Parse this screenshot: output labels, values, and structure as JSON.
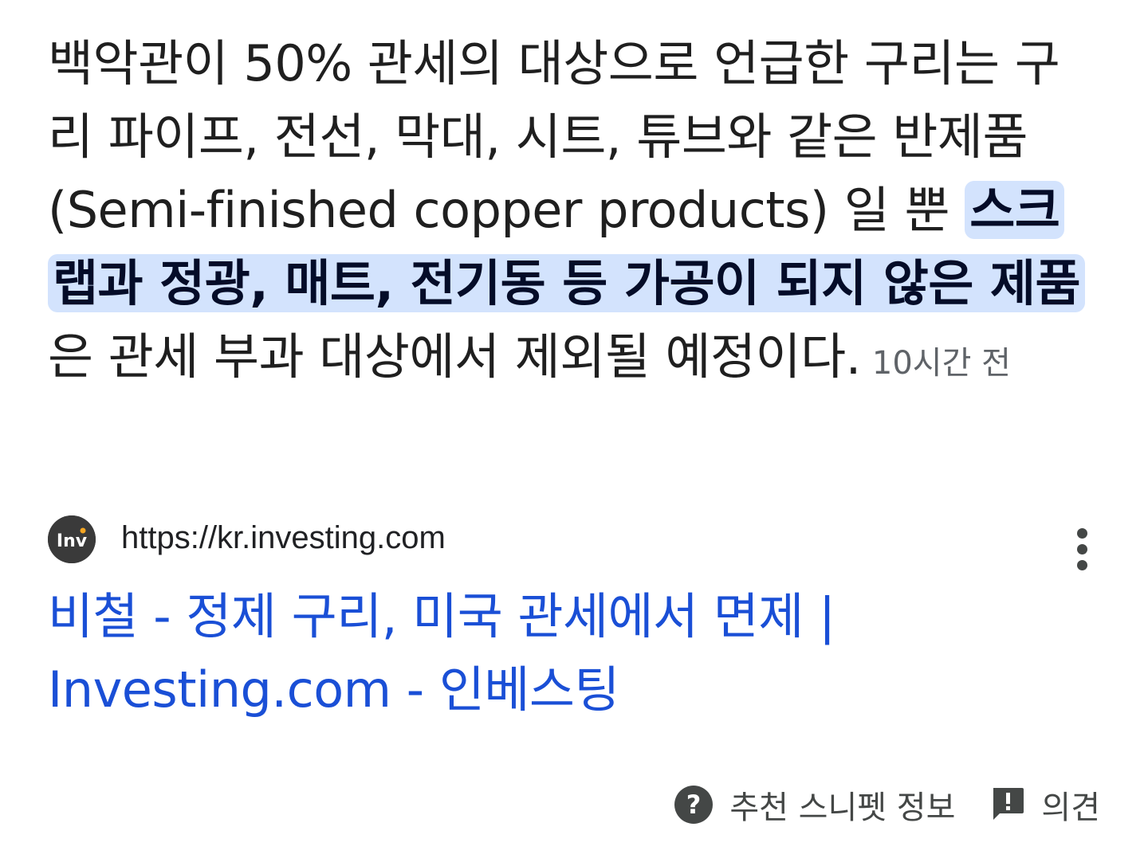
{
  "snippet": {
    "text_before": "백악관이 50% 관세의 대상으로 언급한 구리는 구리 파이프, 전선, 막대, 시트, 튜브와 같은 반제품(Semi-finished copper products) 일 뿐 ",
    "highlight": "스크랩과 정광, 매트, 전기동 등 가공이 되지 않은 제품",
    "text_after": "은 관세 부과 대상에서 제외될 예정이다.",
    "age": "10시간 전"
  },
  "source": {
    "favicon_text": "Inv",
    "url": "https://kr.investing.com"
  },
  "result": {
    "title": "비철 - 정제 구리, 미국 관세에서 면제 | Investing.com - 인베스팅"
  },
  "footer": {
    "about_label": "추천 스니펫 정보",
    "feedback_label": "의견"
  },
  "colors": {
    "link": "#1a4fd6",
    "highlight_bg": "#d3e3fd",
    "text": "#1f1f1f",
    "muted": "#5f6368"
  },
  "icons": {
    "favicon": "investing-logo-icon",
    "more": "more-vert-icon",
    "about": "help-circle-icon",
    "feedback": "feedback-icon"
  }
}
